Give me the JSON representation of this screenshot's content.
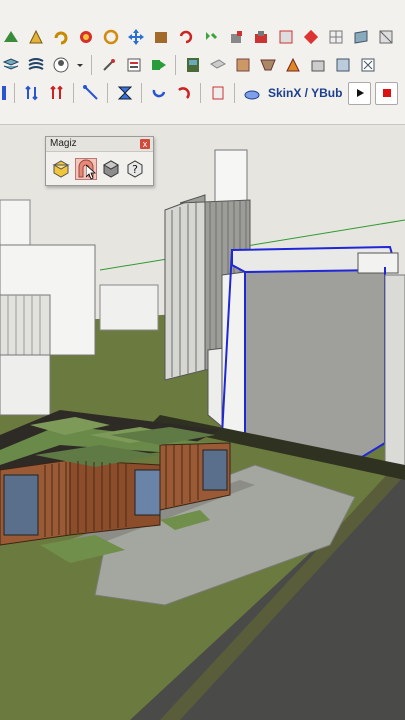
{
  "toolbar": {
    "row1": [
      "tape-measure-icon",
      "protractor-icon",
      "rotate-icon",
      "follow-me-icon",
      "orbit-icon",
      "move-icon",
      "component-icon",
      "undo-icon",
      "redo-arc-icon",
      "paint-bucket-icon",
      "material-icon",
      "sandbox-icon",
      "texture-icon",
      "grid-icon",
      "section-icon",
      "flip-icon"
    ],
    "row2": [
      "layers-icon",
      "styles-icon",
      "user-icon",
      "dropdown-icon",
      "paste-icon",
      "outliner-icon",
      "export-icon",
      "sketchup-icon",
      "camera-icon",
      "shadow-icon",
      "fog-icon",
      "paint-icon",
      "scale-icon",
      "copy-icon",
      "delete-icon"
    ],
    "row3": [
      "pipe-icon",
      "arrows-icon",
      "arrows-up-icon",
      "line-icon",
      "hourglass-icon",
      "arc-icon",
      "arc-red-icon",
      "info-icon",
      "skin-icon",
      "play-icon",
      "stop-icon",
      "help-icon"
    ],
    "skin_label": "SkinX / YBub"
  },
  "palette": {
    "title": "Magiz",
    "close": "x",
    "buttons": [
      "box-yellow-icon",
      "arch-pink-icon",
      "cube-gray-icon",
      "help-icon"
    ]
  },
  "colors": {
    "sky": "#e6e5e0",
    "grass": "#6b7a3e",
    "selection": "#1f27d6"
  }
}
